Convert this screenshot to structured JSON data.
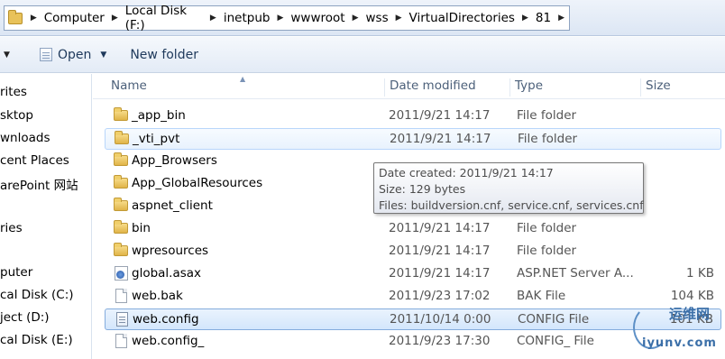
{
  "address_bar": {
    "crumbs": [
      "Computer",
      "Local Disk (F:)",
      "inetpub",
      "wwwroot",
      "wss",
      "VirtualDirectories",
      "81"
    ]
  },
  "toolbar": {
    "open_label": "Open",
    "new_folder_label": "New folder"
  },
  "nav": {
    "items": [
      "rites",
      "sktop",
      "wnloads",
      "cent Places",
      "arePoint 网站",
      "ries",
      "puter",
      "cal Disk (C:)",
      "ject (D:)",
      "cal Disk (E:)"
    ]
  },
  "columns": {
    "name": "Name",
    "date": "Date modified",
    "type": "Type",
    "size": "Size"
  },
  "files": [
    {
      "name": "_app_bin",
      "date": "2011/9/21 14:17",
      "type": "File folder",
      "size": "",
      "icon": "folder"
    },
    {
      "name": "_vti_pvt",
      "date": "2011/9/21 14:17",
      "type": "File folder",
      "size": "",
      "icon": "folder"
    },
    {
      "name": "App_Browsers",
      "date": "",
      "type": "",
      "size": "",
      "icon": "folder"
    },
    {
      "name": "App_GlobalResources",
      "date": "",
      "type": "",
      "size": "",
      "icon": "folder"
    },
    {
      "name": "aspnet_client",
      "date": "",
      "type": "",
      "size": "",
      "icon": "folder"
    },
    {
      "name": "bin",
      "date": "2011/9/21 14:17",
      "type": "File folder",
      "size": "",
      "icon": "folder"
    },
    {
      "name": "wpresources",
      "date": "2011/9/21 14:17",
      "type": "File folder",
      "size": "",
      "icon": "folder"
    },
    {
      "name": "global.asax",
      "date": "2011/9/21 14:17",
      "type": "ASP.NET Server A...",
      "size": "1 KB",
      "icon": "asax"
    },
    {
      "name": "web.bak",
      "date": "2011/9/23 17:02",
      "type": "BAK File",
      "size": "104 KB",
      "icon": "file"
    },
    {
      "name": "web.config",
      "date": "2011/10/14 0:00",
      "type": "CONFIG File",
      "size": "101 KB",
      "icon": "config"
    },
    {
      "name": "web.config_",
      "date": "2011/9/23 17:30",
      "type": "CONFIG_ File",
      "size": "",
      "icon": "file"
    }
  ],
  "tooltip": {
    "created": "Date created: 2011/9/21 14:17",
    "size": "Size: 129 bytes",
    "files": "Files: buildversion.cnf, service.cnf, services.cnf"
  },
  "watermark": {
    "line1": "运维网",
    "line2": "iyunv.com"
  }
}
